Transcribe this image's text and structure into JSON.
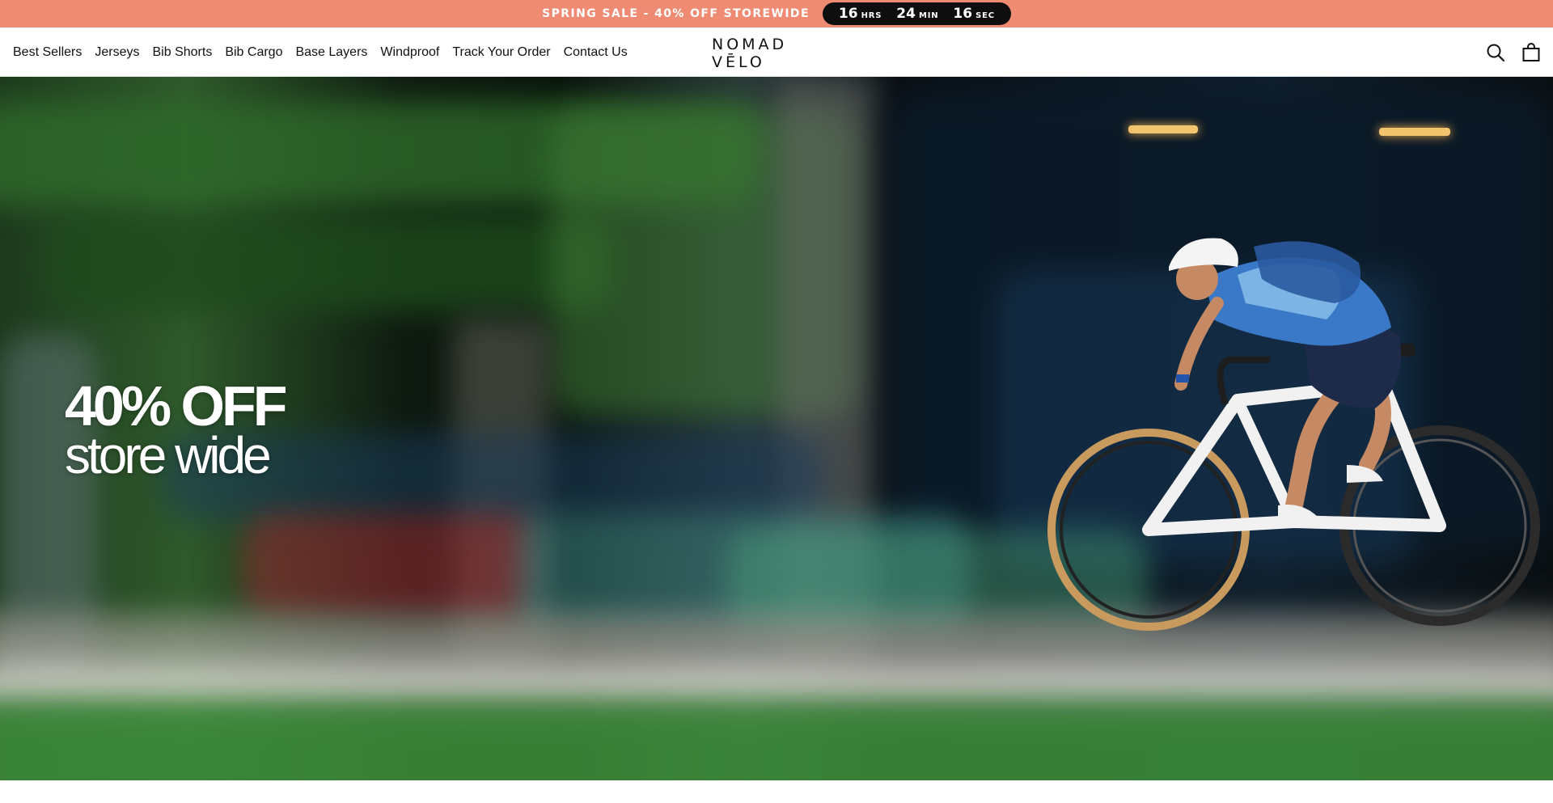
{
  "announcement": {
    "text": "SPRING SALE - 40% OFF STOREWIDE",
    "countdown": {
      "hours": "16",
      "hours_label": "HRS",
      "minutes": "24",
      "minutes_label": "MIN",
      "seconds": "16",
      "seconds_label": "SEC"
    },
    "background_color": "#ef8b73"
  },
  "header": {
    "nav": [
      {
        "label": "Best Sellers"
      },
      {
        "label": "Jerseys"
      },
      {
        "label": "Bib Shorts"
      },
      {
        "label": "Bib Cargo"
      },
      {
        "label": "Base Layers"
      },
      {
        "label": "Windproof"
      },
      {
        "label": "Track Your Order"
      },
      {
        "label": "Contact Us"
      }
    ],
    "logo": "NOMAD VĒLO",
    "icons": [
      "search-icon",
      "cart-icon"
    ]
  },
  "hero": {
    "line1": "40% OFF",
    "line2": "store wide"
  }
}
